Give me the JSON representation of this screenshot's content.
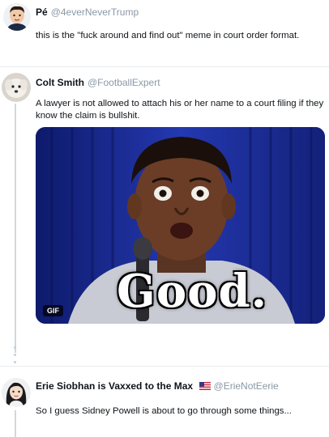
{
  "tweets": [
    {
      "name": "Pé",
      "handle": "@4everNeverTrump",
      "text": "this is the \"fuck around and find out\" meme in court order format."
    },
    {
      "name": "Colt Smith",
      "handle": "@FootballExpert",
      "text": "A lawyer is not allowed to attach his or her name to a court filing if they know the claim is bullshit.",
      "media": {
        "badge": "GIF",
        "caption": "Good."
      }
    },
    {
      "name": "Erie Siobhan is Vaxxed to the Max",
      "flag_icon": "us-flag-icon",
      "handle": "@ErieNotEerie",
      "text": "So I guess Sidney Powell is about to go through some things..."
    }
  ],
  "colors": {
    "handle": "#8a99a6",
    "gif_background": "#1a2b8c",
    "thread_line": "#cfd9de"
  }
}
